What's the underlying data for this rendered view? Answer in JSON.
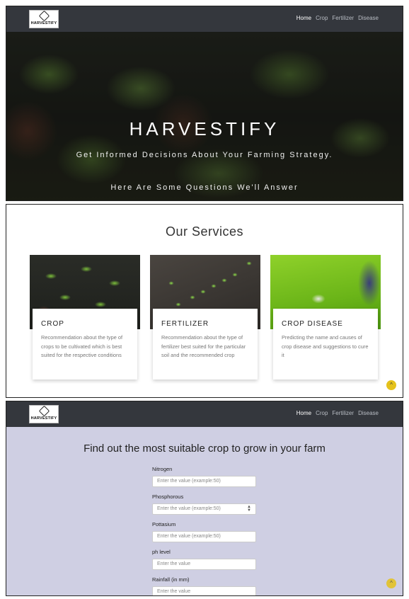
{
  "nav": {
    "logo_text": "HARVESTIFY",
    "links": [
      "Home",
      "Crop",
      "Fertilizer",
      "Disease"
    ]
  },
  "hero": {
    "title": "HARVESTIFY",
    "subtitle": "Get Informed Decisions About Your Farming Strategy.",
    "question": "Here Are Some Questions We'll Answer"
  },
  "services": {
    "title": "Our Services",
    "cards": [
      {
        "title": "CROP",
        "text": "Recommendation about the type of crops to be cultivated which is best suited for the respective conditions"
      },
      {
        "title": "FERTILIZER",
        "text": "Recommendation about the type of fertilizer best suited for the particular soil and the recommended crop"
      },
      {
        "title": "CROP DISEASE",
        "text": "Predicting the name and causes of crop disease and suggestions to cure it"
      }
    ]
  },
  "form": {
    "title": "Find out the most suitable crop to grow in your farm",
    "fields": [
      {
        "label": "Nitrogen",
        "placeholder": "Enter the value (example:50)"
      },
      {
        "label": "Phosphorous",
        "placeholder": "Enter the value (example:50)"
      },
      {
        "label": "Pottasium",
        "placeholder": "Enter the value (example:50)"
      },
      {
        "label": "ph level",
        "placeholder": "Enter the value"
      },
      {
        "label": "Rainfall (in mm)",
        "placeholder": "Enter the value"
      }
    ]
  },
  "colors": {
    "navbar": "#34373d",
    "form_bg": "#cfcfe3",
    "scroll_button": "#e5c21b"
  },
  "icons": {
    "scroll_top": "chevron-up-icon"
  }
}
